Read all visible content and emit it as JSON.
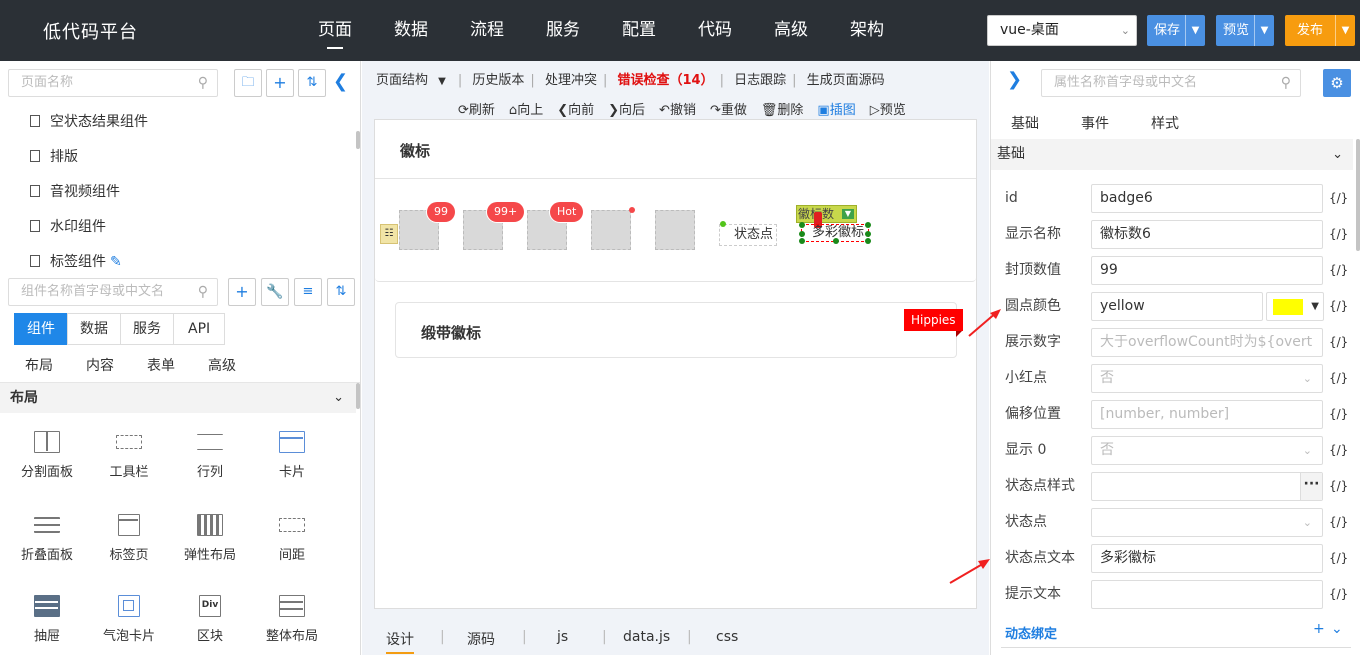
{
  "topbar": {
    "logo": "低代码平台",
    "nav": [
      "页面",
      "数据",
      "流程",
      "服务",
      "配置",
      "代码",
      "高级",
      "架构"
    ],
    "env_select": "vue-桌面",
    "save": "保存",
    "preview": "预览",
    "publish": "发布",
    "colors": {
      "bg": "#2b3036",
      "save": "#4a90e2",
      "preview": "#4a90e2",
      "publish": "#f79c0f"
    }
  },
  "left": {
    "page_search_placeholder": "页面名称",
    "tree": [
      "空状态结果组件",
      "排版",
      "音视频组件",
      "水印组件",
      "标签组件"
    ],
    "comp_search_placeholder": "组件名称首字母或中文名",
    "tabs": [
      "组件",
      "数据",
      "服务",
      "API"
    ],
    "subtabs": [
      "布局",
      "内容",
      "表单",
      "高级"
    ],
    "section": "布局",
    "components": [
      "分割面板",
      "工具栏",
      "行列",
      "卡片",
      "折叠面板",
      "标签页",
      "弹性布局",
      "间距",
      "抽屉",
      "气泡卡片",
      "区块",
      "整体布局"
    ]
  },
  "center": {
    "toolbar1": [
      "页面结构",
      "历史版本",
      "处理冲突",
      "错误检查（14）",
      "日志跟踪",
      "生成页面源码"
    ],
    "toolbar2": [
      "刷新",
      "向上",
      "向前",
      "向后",
      "撤销",
      "重做",
      "删除",
      "插图",
      "预览"
    ],
    "card1_title": "徽标",
    "badges": [
      "99",
      "99+",
      "Hot"
    ],
    "status_dot_label": "状态点",
    "colorful_badge_tag": "徽标数",
    "colorful_badge_label": "多彩徽标",
    "card2_title": "缎带徽标",
    "ribbon_text": "Hippies",
    "bottom_tabs": [
      "设计",
      "源码",
      "js",
      "data.js",
      "css"
    ]
  },
  "right": {
    "search_placeholder": "属性名称首字母或中文名",
    "tabs": [
      "基础",
      "事件",
      "样式"
    ],
    "section": "基础",
    "fields": [
      {
        "label": "id",
        "value": "badge6",
        "placeholder": false,
        "type": "text"
      },
      {
        "label": "显示名称",
        "value": "徽标数6",
        "placeholder": false,
        "type": "text"
      },
      {
        "label": "封顶数值",
        "value": "99",
        "placeholder": false,
        "type": "text"
      },
      {
        "label": "圆点颜色",
        "value": "yellow",
        "placeholder": false,
        "type": "color"
      },
      {
        "label": "展示数字",
        "value": "大于overflowCount时为${overt",
        "placeholder": true,
        "type": "text"
      },
      {
        "label": "小红点",
        "value": "否",
        "placeholder": true,
        "type": "select"
      },
      {
        "label": "偏移位置",
        "value": "[number, number]",
        "placeholder": true,
        "type": "text"
      },
      {
        "label": "显示 0",
        "value": "否",
        "placeholder": true,
        "type": "select"
      },
      {
        "label": "状态点样式",
        "value": "",
        "placeholder": false,
        "type": "more"
      },
      {
        "label": "状态点",
        "value": "",
        "placeholder": false,
        "type": "select"
      },
      {
        "label": "状态点文本",
        "value": "多彩徽标",
        "placeholder": false,
        "type": "text"
      },
      {
        "label": "提示文本",
        "value": "",
        "placeholder": false,
        "type": "text"
      }
    ],
    "code_marker": "{/}",
    "dynamic_binding": "动态绑定",
    "swatch_color": "#ffff00"
  }
}
